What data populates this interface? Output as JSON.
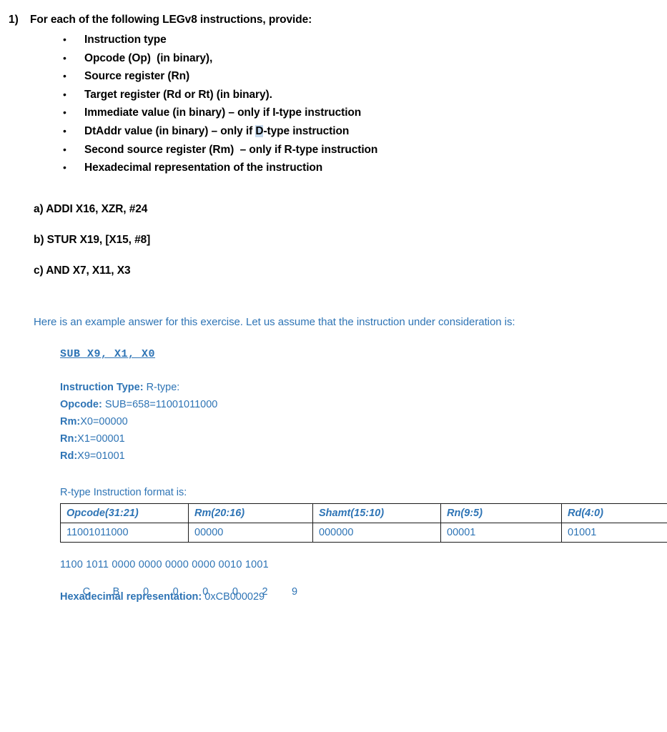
{
  "question": {
    "number": "1)",
    "prompt": "For each of the following LEGv8 instructions, provide:",
    "bullets": [
      {
        "text": "Instruction type"
      },
      {
        "text": "Opcode (Op)  (in binary),"
      },
      {
        "text": "Source register (Rn)"
      },
      {
        "text": "Target register (Rd or Rt) (in binary)."
      },
      {
        "text": "Immediate value (in binary) – only if I-type instruction"
      },
      {
        "pre": "DtAddr value (in binary) – only if ",
        "highlight": "D",
        "post": "-type instruction"
      },
      {
        "text": "Second source register (Rm)  – only if R-type instruction"
      },
      {
        "text": "Hexadecimal representation of the instruction"
      }
    ]
  },
  "instructions": [
    {
      "label": "a) ADDI X16, XZR, #24"
    },
    {
      "label": "b) STUR X19, [X15, #8]"
    },
    {
      "label": "c) AND X7, X11, X3"
    }
  ],
  "example": {
    "intro": "Here is an example answer for this exercise. Let us assume that the instruction under consideration is:",
    "code": "SUB X9, X1, X0",
    "details": [
      {
        "label": "Instruction Type:",
        "value": " R-type:"
      },
      {
        "label": "Opcode:",
        "value": " SUB=658=11001011000"
      },
      {
        "label": "Rm:",
        "value": "X0=00000"
      },
      {
        "label": "Rn:",
        "value": "X1=00001"
      },
      {
        "label": "Rd:",
        "value": "X9=01001"
      }
    ],
    "format_caption": "R-type Instruction format is:",
    "table": {
      "headers": [
        "Opcode(31:21)",
        "Rm(20:16)",
        "Shamt(15:10)",
        "Rn(9:5)",
        "Rd(4:0)"
      ],
      "values": [
        "11001011000",
        "00000",
        "000000",
        "00001",
        "01001"
      ]
    },
    "binary_line": "1100 1011 0000 0000 0000 0000 0010 1001",
    "hex_digits": [
      "C",
      "B",
      "0",
      "0",
      "0",
      "0",
      "2",
      "9"
    ],
    "hex_label": "Hexadecimal representation:",
    "hex_value": " 0xCB000029"
  },
  "colors": {
    "accent_blue": "#2E74B5",
    "highlight": "#c5d9ed",
    "text_black": "#000000",
    "table_border": "#1b1b1b"
  }
}
